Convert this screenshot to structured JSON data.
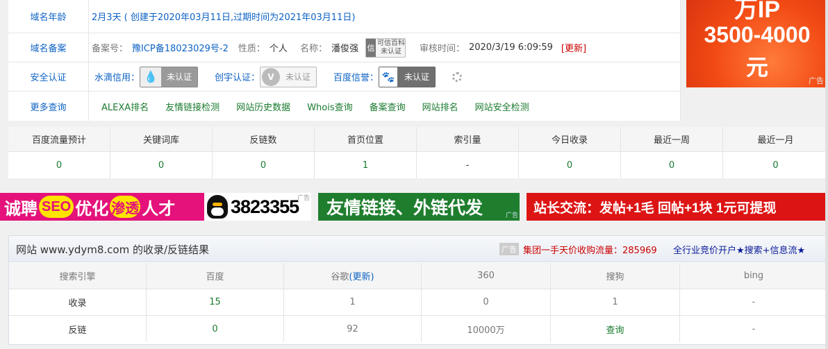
{
  "domain_info": {
    "age": {
      "label": "域名年龄",
      "value": "2月3天 ( 创建于2020年03月11日,过期时间为2021年03月11日)"
    },
    "icp": {
      "label": "域名备案",
      "number_label": "备案号：",
      "number": "豫ICP备18023029号-2",
      "nature_label": "性质：",
      "nature": "个人",
      "name_label": "名称：",
      "name": "潘俊强",
      "badge_line1": "可信百科",
      "badge_line2": "未认证",
      "review_label": "审核时间：",
      "review_time": "2020/3/19 6:09:59",
      "update_link": "[更新]"
    },
    "security": {
      "label": "安全认证",
      "shuidi_label": "水滴信用：",
      "shuidi_badge": "未认证",
      "chuangyu_label": "创宇认证：",
      "chuangyu_badge": "未认证",
      "baidu_label": "百度信誉：",
      "baidu_badge": "未认证"
    },
    "more": {
      "label": "更多查询",
      "links": [
        "ALEXA排名",
        "友情链接检测",
        "网站历史数据",
        "Whois查询",
        "备案查询",
        "网站排名",
        "网站安全检测"
      ]
    }
  },
  "ad_right": {
    "line1": "万IP",
    "line2": "3500-4000",
    "line3": "元",
    "tag": "广告"
  },
  "stats": {
    "headers": [
      "百度流量预计",
      "关键词库",
      "反链数",
      "首页位置",
      "索引量",
      "今日收录",
      "最近一周",
      "最近一月"
    ],
    "values": [
      "0",
      "0",
      "0",
      "1",
      "-",
      "0",
      "0",
      "0"
    ]
  },
  "banners": {
    "b1_part1": "诚聘",
    "b1_seo": "SEO",
    "b1_part2": "优化",
    "b1_shentou": "渗透",
    "b1_part3": "人才",
    "b2_number": "3823355",
    "b2_tag": "广告",
    "b3_text": "友情链接、外链代发",
    "b3_tag": "广告",
    "b4_text": "站长交流：发帖+1毛  回帖+1块  1元可提现"
  },
  "result": {
    "title": "网站 www.ydym8.com 的收录/反链结果",
    "ad_tag": "广告",
    "ad1": "集团一手天价收购流量：285969",
    "ad2": "全行业竞价开户★搜索+信息流★",
    "headers": [
      "搜索引擎",
      "百度",
      "谷歌",
      "360",
      "搜狗",
      "bing"
    ],
    "google_update": "(更新)",
    "rows": [
      {
        "label": "收录",
        "values": [
          "15",
          "1",
          "0",
          "1",
          "-"
        ]
      },
      {
        "label": "反链",
        "values": [
          "0",
          "92",
          "10000万",
          "查询",
          "-"
        ]
      }
    ]
  }
}
